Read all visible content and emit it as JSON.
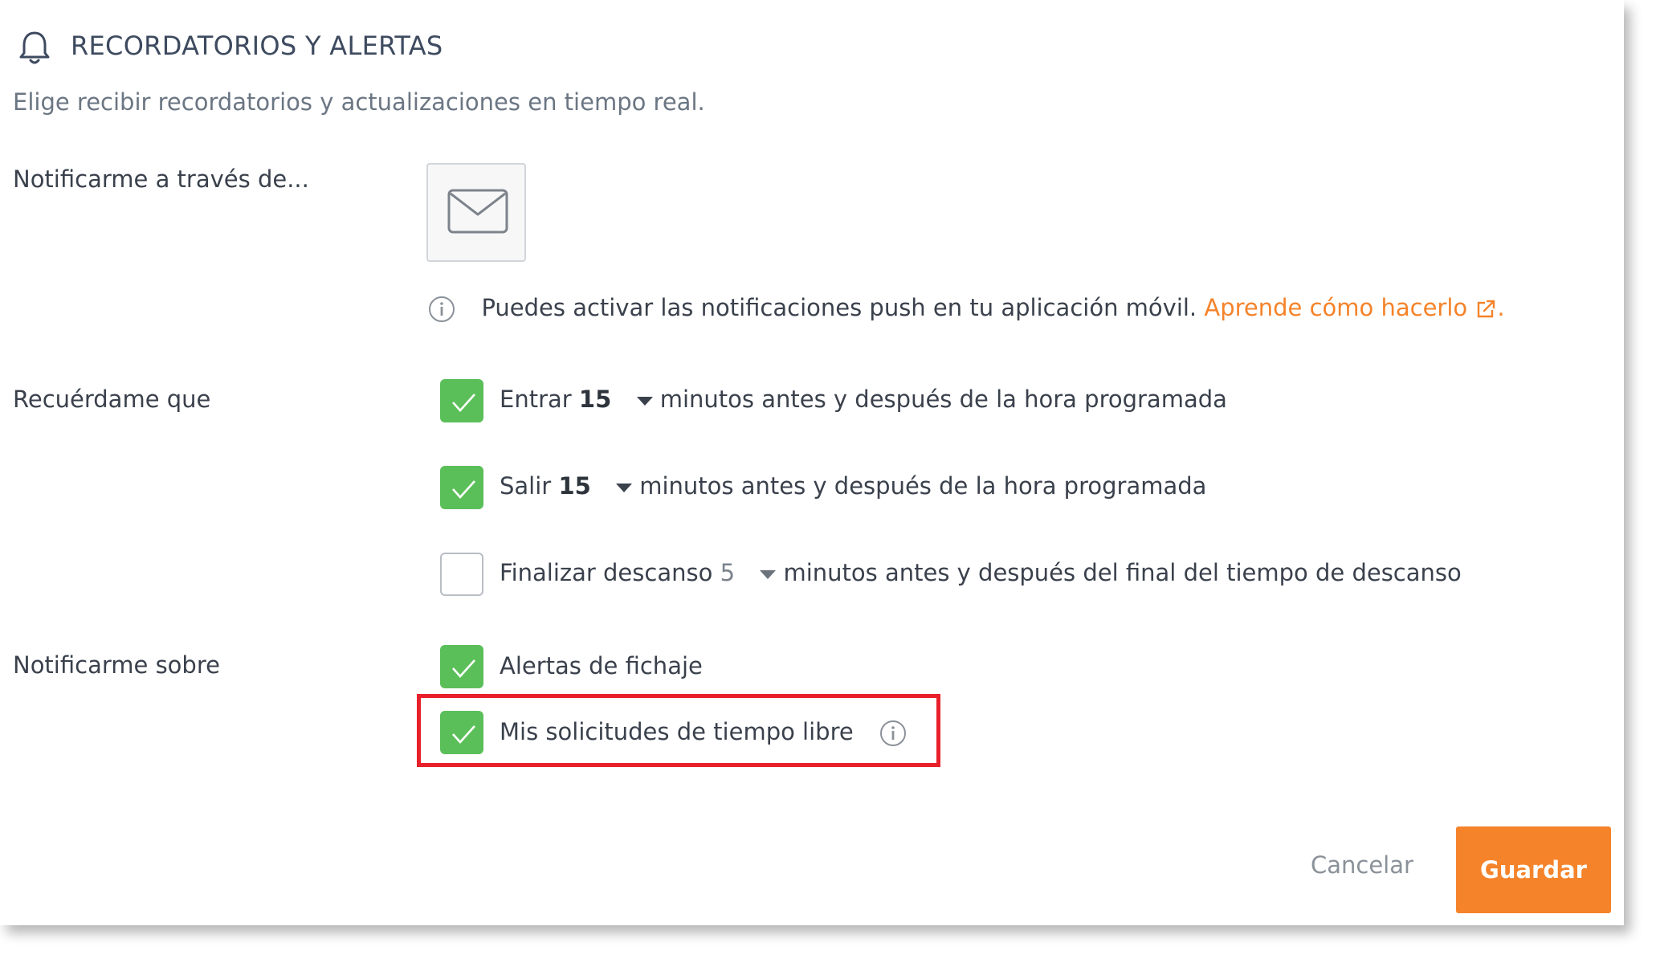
{
  "header": {
    "icon": "bell-icon",
    "title": "RECORDATORIOS Y ALERTAS",
    "subtitle": "Elige recibir recordatorios y actualizaciones en tiempo real."
  },
  "notify_via": {
    "label": "Notificarme a través de...",
    "channel_icon": "envelope-icon",
    "info_text": "Puedes activar las notificaciones push en tu aplicación móvil.",
    "info_link": "Aprende cómo hacerlo",
    "info_link_suffix": "."
  },
  "remind_me": {
    "label": "Recuérdame que",
    "items": [
      {
        "checked": true,
        "prefix": "Entrar",
        "value": "15",
        "suffix": "minutos antes y después de la hora programada"
      },
      {
        "checked": true,
        "prefix": "Salir",
        "value": "15",
        "suffix": "minutos antes y después de la hora programada"
      },
      {
        "checked": false,
        "prefix": "Finalizar descanso",
        "value": "5",
        "suffix": "minutos antes y después del final del tiempo de descanso"
      }
    ]
  },
  "notify_about": {
    "label": "Notificarme sobre",
    "items": [
      {
        "checked": true,
        "label": "Alertas de fichaje"
      },
      {
        "checked": true,
        "label": "Mis solicitudes de tiempo libre"
      }
    ]
  },
  "actions": {
    "cancel_label": "Cancelar",
    "save_label": "Guardar"
  },
  "colors": {
    "accent": "#f5832a",
    "checkbox_on": "#5bbf59",
    "highlight": "#e8202a"
  }
}
